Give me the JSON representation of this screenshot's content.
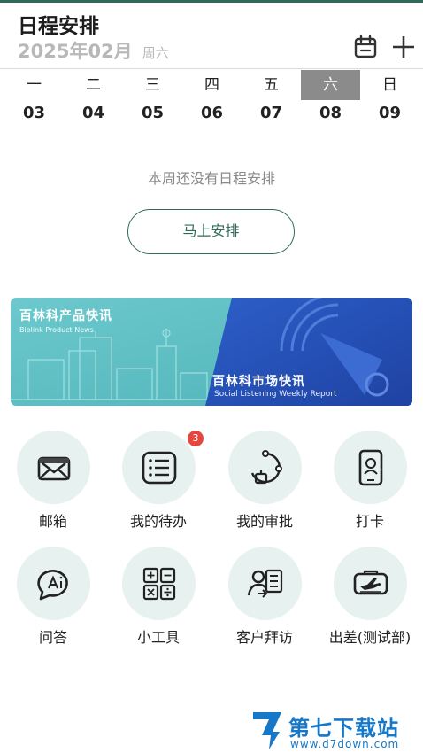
{
  "header": {
    "title": "日程安排",
    "date": "2025年02月",
    "weekday": "周六"
  },
  "week": {
    "days": [
      {
        "name": "一",
        "num": "03"
      },
      {
        "name": "二",
        "num": "04"
      },
      {
        "name": "三",
        "num": "05"
      },
      {
        "name": "四",
        "num": "06"
      },
      {
        "name": "五",
        "num": "07"
      },
      {
        "name": "六",
        "num": "08"
      },
      {
        "name": "日",
        "num": "09"
      }
    ],
    "selected": "六"
  },
  "empty": {
    "message": "本周还没有日程安排",
    "button_label": "马上安排"
  },
  "banner": {
    "left_title": "百林科产品快讯",
    "left_subtitle": "Biolink Product News",
    "right_title": "百林科市场快讯",
    "right_subtitle": "Social Listening Weekly Report"
  },
  "apps": [
    {
      "label": "邮箱",
      "icon": "mail-icon"
    },
    {
      "label": "我的待办",
      "icon": "todo-list-icon",
      "badge": "3"
    },
    {
      "label": "我的审批",
      "icon": "approval-icon"
    },
    {
      "label": "打卡",
      "icon": "phone-checkin-icon"
    },
    {
      "label": "问答",
      "icon": "qa-bubble-icon"
    },
    {
      "label": "小工具",
      "icon": "calculator-icon"
    },
    {
      "label": "客户拜访",
      "icon": "customer-visit-icon"
    },
    {
      "label": "出差(测试部)",
      "icon": "travel-ticket-icon"
    }
  ],
  "watermark": {
    "name": "第七下载站",
    "url": "www.d7down.com"
  },
  "colors": {
    "accent": "#2f6b5b",
    "icon_bg": "#e6f1f0",
    "selected_day_bg": "#8b8b8b",
    "badge": "#e5473f",
    "banner_left": "#5fbfc4",
    "banner_right": "#2450b8",
    "watermark": "#1778c9"
  }
}
